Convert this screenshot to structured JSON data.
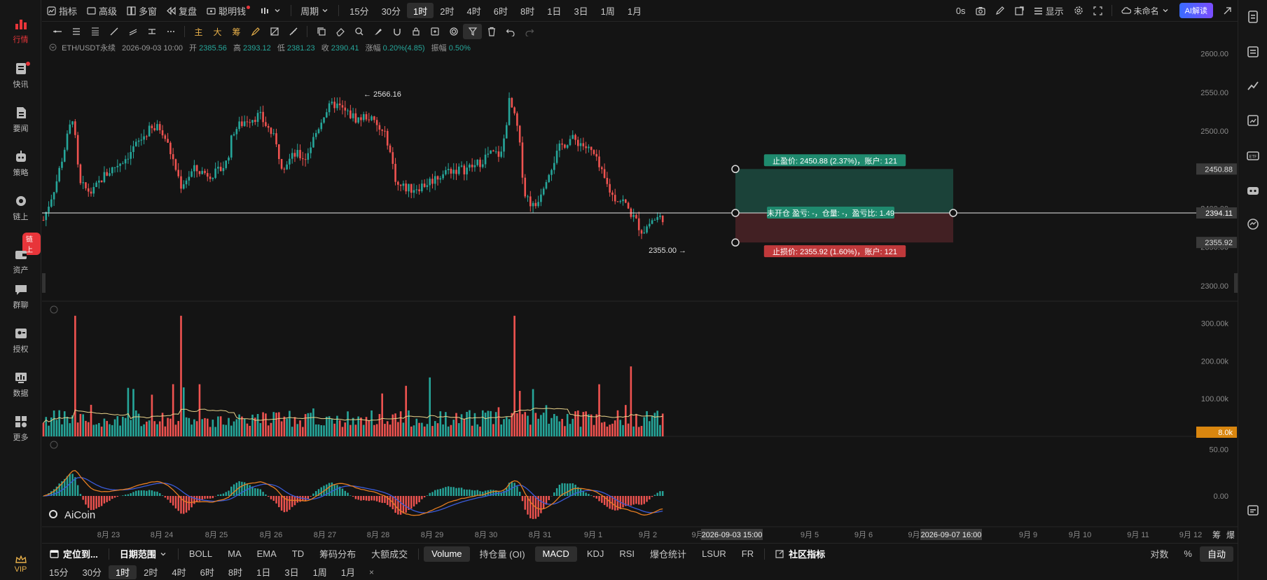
{
  "sidebar": {
    "items": [
      {
        "label": "行情",
        "icon": "market-chart-icon",
        "active": true
      },
      {
        "label": "快讯",
        "icon": "news-flash-icon",
        "dot": true
      },
      {
        "label": "要闻",
        "icon": "headline-doc-icon"
      },
      {
        "label": "策略",
        "icon": "robot-strategy-icon"
      },
      {
        "label": "链上",
        "icon": "onchain-icon"
      },
      {
        "label": "资产",
        "icon": "wallet-asset-icon",
        "tag": "链上"
      },
      {
        "label": "群聊",
        "icon": "chat-icon"
      },
      {
        "label": "授权",
        "icon": "authorize-icon"
      },
      {
        "label": "数据",
        "icon": "data-monitor-icon"
      },
      {
        "label": "更多",
        "icon": "more-grid-icon"
      }
    ],
    "vip_label": "VIP"
  },
  "topbar": {
    "left": [
      "指标",
      "高级",
      "多窗",
      "复盘",
      "聪明钱"
    ],
    "period_dropdown": "周期",
    "periods": [
      "15分",
      "30分",
      "1时",
      "2时",
      "4时",
      "6时",
      "8时",
      "1日",
      "3日",
      "1周",
      "1月"
    ],
    "selected_period": "1时",
    "countdown": "0s",
    "display_label": "显示",
    "layout_name": "未命名",
    "ai_button": "AI解读"
  },
  "drawbar": {
    "highlight_tools": [
      "主",
      "大",
      "筹"
    ]
  },
  "info": {
    "symbol": "ETH/USDT永续",
    "datetime": "2026-09-03 10:00",
    "open_label": "开",
    "open": "2385.56",
    "high_label": "高",
    "high": "2393.12",
    "low_label": "低",
    "low": "2381.23",
    "close_label": "收",
    "close": "2390.41",
    "change_label": "涨幅",
    "change": "0.20%(4.85)",
    "amp_label": "振幅",
    "amp": "0.50%"
  },
  "chart_data": {
    "type": "candlestick",
    "price_axis": [
      "2600.00",
      "2550.00",
      "2500.00",
      "2450.00",
      "2400.00",
      "2350.00",
      "2300.00"
    ],
    "ylim": [
      2280,
      2615
    ],
    "high_marker": "2566.16",
    "low_marker": "2355.00",
    "current_price": "2394.11",
    "take_profit_price": "2450.88",
    "stop_loss_price": "2355.92",
    "take_profit_label": "止盈价: 2450.88 (2.37%)，账户: 121",
    "stop_loss_label": "止损价: 2355.92 (1.60%)，账户: 121",
    "position_label": "未开仓 盈亏: -，仓量: -，盈亏比: 1.49",
    "volume_axis": [
      "300.00k",
      "200.00k",
      "100.00k"
    ],
    "volume_ylim": [
      0,
      340000
    ],
    "volume_current": "8.0k",
    "macd_axis": [
      "50.00",
      "0.00"
    ],
    "x_labels": [
      "8月 23",
      "8月 24",
      "8月 25",
      "8月 26",
      "8月 27",
      "8月 28",
      "8月 29",
      "8月 30",
      "8月 31",
      "9月 1",
      "9月 2",
      "9月",
      "9月 5",
      "9月 6",
      "9月",
      "9月 9",
      "9月 10",
      "9月 11",
      "9月 12"
    ],
    "x_highlight_1": "2026-09-03 15:00",
    "x_highlight_2": "2026-09-07 16:00",
    "right_icons_bottom": [
      "筹",
      "爆"
    ],
    "watermark": "AiCoin",
    "colors": {
      "up": "#26a69a",
      "down": "#ef5350",
      "ma": "#e8d28a",
      "dif": "#e67e22",
      "dea": "#3a5bd9",
      "tp_zone": "#1c4a40",
      "sl_zone": "#4a2226"
    }
  },
  "bottombar": {
    "locate": "定位到...",
    "date_range": "日期范围",
    "indicators": [
      "BOLL",
      "MA",
      "EMA",
      "TD",
      "筹码分布",
      "大额成交"
    ],
    "sub_indicators": [
      "Volume",
      "持仓量 (OI)",
      "MACD",
      "KDJ",
      "RSI",
      "爆仓统计",
      "LSUR",
      "FR"
    ],
    "selected_sub": [
      "Volume",
      "MACD"
    ],
    "community": "社区指标",
    "scale_opts": [
      "对数",
      "%",
      "自动"
    ],
    "scale_selected": "自动"
  },
  "periodrow": {
    "periods": [
      "15分",
      "30分",
      "1时",
      "2时",
      "4时",
      "6时",
      "8时",
      "1日",
      "3日",
      "1周",
      "1月"
    ],
    "selected": "1时",
    "close": "×"
  }
}
